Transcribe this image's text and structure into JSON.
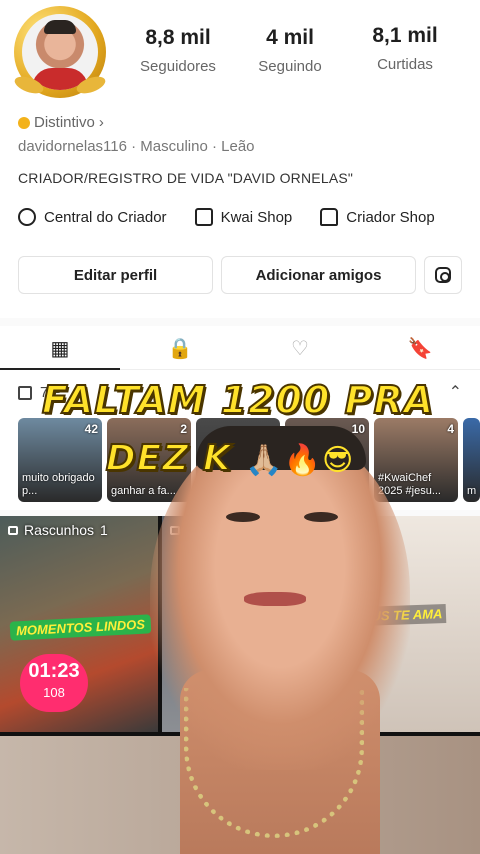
{
  "profile": {
    "followers": {
      "value": "8,8 mil",
      "label": "Seguidores"
    },
    "following": {
      "value": "4 mil",
      "label": "Seguindo"
    },
    "likes": {
      "value": "8,1 mil",
      "label": "Curtidas"
    },
    "badge_label": "Distintivo",
    "badge_chevron": "›",
    "meta": "davidornelas116 · Masculino · Leão",
    "bio": "CRIADOR/REGISTRO DE VIDA \"DAVID ORNELAS\""
  },
  "links": [
    {
      "label": "Central do Criador",
      "icon": "lightning-icon"
    },
    {
      "label": "Kwai Shop",
      "icon": "bag-icon"
    },
    {
      "label": "Criador Shop",
      "icon": "store-icon"
    }
  ],
  "actions": {
    "edit": "Editar perfil",
    "add": "Adicionar amigos",
    "instagram_icon": "instagram-icon"
  },
  "tabs": [
    {
      "icon": "grid-icon",
      "glyph": "▦",
      "active": true
    },
    {
      "icon": "lock-icon",
      "glyph": "🔒",
      "active": false
    },
    {
      "icon": "heart-icon",
      "glyph": "♡",
      "active": false
    },
    {
      "icon": "bookmark-icon",
      "glyph": "🔖",
      "active": false
    }
  ],
  "collection": {
    "title": "7 P",
    "chevron": "⌃",
    "items": [
      {
        "count": "42",
        "caption": "muito obrigado p...",
        "color": "#6e8aa0"
      },
      {
        "count": "2",
        "caption": "ganhar a fa...",
        "color": "#8b6d5b"
      },
      {
        "count": "",
        "caption": "",
        "color": "#4a4a4a"
      },
      {
        "count": "10",
        "caption": "",
        "color": "#6b5a52"
      },
      {
        "count": "4",
        "caption": "#KwaiChef 2025 #jesu...",
        "color": "#9c7b66"
      },
      {
        "count": "",
        "caption": "m",
        "color": "#3a6aa8"
      }
    ]
  },
  "grid": {
    "drafts_label": "Rascunhos",
    "drafts_count": "1",
    "private_label": "Me",
    "sticker_momentos": "MOMENTOS LINDOS",
    "timer_time": "01:23",
    "timer_coins": "108",
    "sticker_jesus": "...JESUS TE AMA"
  },
  "overlay": {
    "line1": "FALTAM 1200 PRA",
    "line2": "DEZ K",
    "emojis": "🙏🏼🔥😎"
  },
  "colors": {
    "accent_gold": "#e2a71e",
    "overlay_yellow": "#ffe22a",
    "timer_pink": "#ff2d6f"
  }
}
